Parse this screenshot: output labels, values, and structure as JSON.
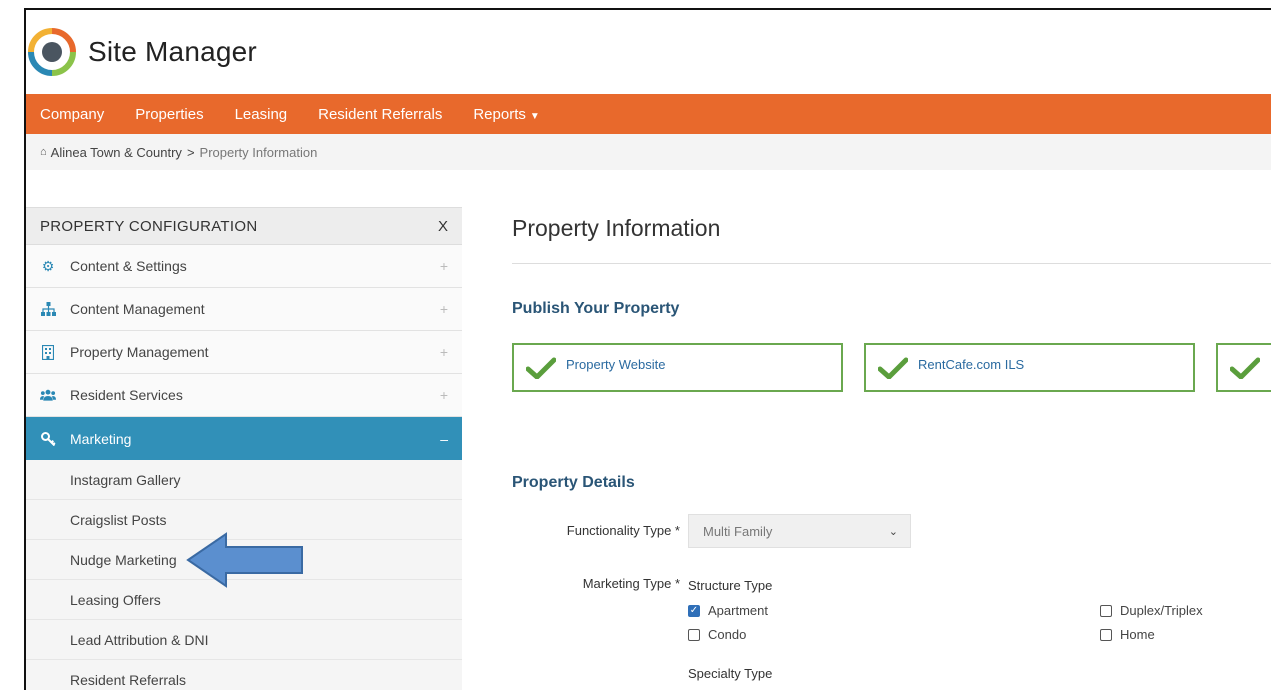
{
  "app": {
    "title": "Site Manager"
  },
  "nav": {
    "items": [
      "Company",
      "Properties",
      "Leasing",
      "Resident Referrals",
      "Reports"
    ]
  },
  "breadcrumb": {
    "home": "Alinea Town & Country",
    "separator": ">",
    "current": "Property Information"
  },
  "sidebar": {
    "title": "PROPERTY CONFIGURATION",
    "close": "X",
    "items": [
      {
        "label": "Content & Settings",
        "icon": "gear-icon",
        "toggle": "+"
      },
      {
        "label": "Content Management",
        "icon": "sitemap-icon",
        "toggle": "+"
      },
      {
        "label": "Property Management",
        "icon": "building-icon",
        "toggle": "+"
      },
      {
        "label": "Resident Services",
        "icon": "users-icon",
        "toggle": "+"
      },
      {
        "label": "Marketing",
        "icon": "key-icon",
        "toggle": "–"
      }
    ],
    "subitems": [
      "Instagram Gallery",
      "Craigslist Posts",
      "Nudge Marketing",
      "Leasing Offers",
      "Lead Attribution & DNI",
      "Resident Referrals"
    ]
  },
  "main": {
    "title": "Property Information",
    "publish": {
      "title": "Publish Your Property",
      "cards": [
        "Property Website",
        "RentCafe.com ILS",
        ""
      ]
    },
    "details": {
      "title": "Property Details",
      "functionality_label": "Functionality Type *",
      "functionality_value": "Multi Family",
      "marketing_label": "Marketing Type *",
      "structure_title": "Structure Type",
      "structure": [
        {
          "label": "Apartment",
          "checked": true
        },
        {
          "label": "Duplex/Triplex",
          "checked": false
        },
        {
          "label": "Condo",
          "checked": false
        },
        {
          "label": "Home",
          "checked": false
        }
      ],
      "specialty_title": "Specialty Type"
    }
  },
  "colors": {
    "accent": "#e8692c",
    "active": "#3190b8",
    "check": "#6aa84f",
    "arrow": "#5b8fcf"
  }
}
